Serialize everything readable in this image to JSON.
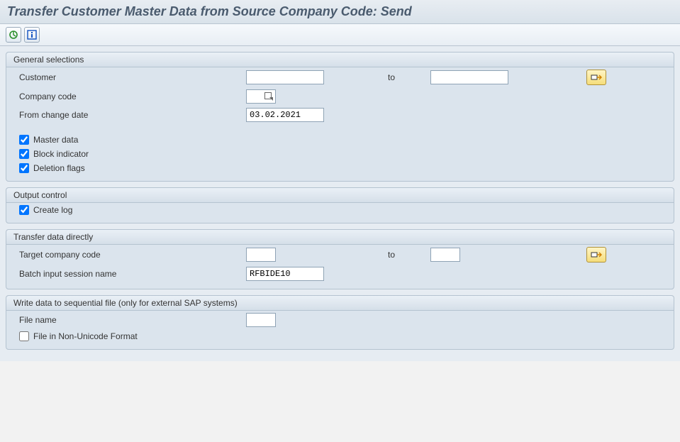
{
  "title": "Transfer Customer Master Data from Source Company Code: Send",
  "groups": {
    "general": {
      "title": "General selections",
      "customer_label": "Customer",
      "to_label": "to",
      "company_code_label": "Company code",
      "company_code_value": "",
      "from_change_date_label": "From change date",
      "from_change_date_value": "03.02.2021",
      "master_data_label": "Master data",
      "block_indicator_label": "Block indicator",
      "deletion_flags_label": "Deletion flags"
    },
    "output": {
      "title": "Output control",
      "create_log_label": "Create log"
    },
    "transfer": {
      "title": "Transfer data directly",
      "target_cc_label": "Target company code",
      "to_label": "to",
      "batch_label": "Batch input session name",
      "batch_value": "RFBIDE10"
    },
    "file": {
      "title": "Write data to sequential file (only for external SAP systems)",
      "filename_label": "File name",
      "nonunicode_label": "File in Non-Unicode Format"
    }
  }
}
